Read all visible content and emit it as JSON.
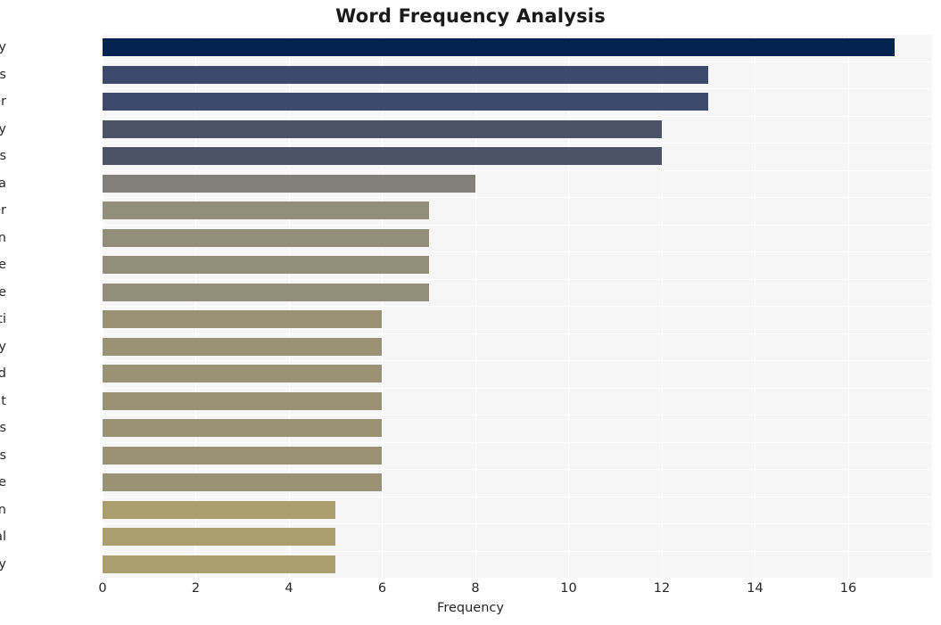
{
  "chart_data": {
    "type": "bar",
    "orientation": "horizontal",
    "title": "Word Frequency Analysis",
    "xlabel": "Frequency",
    "ylabel": "",
    "categories": [
      "security",
      "vulnerabilities",
      "cyber",
      "advisory",
      "organizations",
      "cisa",
      "partner",
      "exploitation",
      "infrastructure",
      "centre",
      "ivanti",
      "cybersecurity",
      "recommend",
      "threat",
      "actors",
      "malicious",
      "urge",
      "action",
      "national",
      "today"
    ],
    "values": [
      17,
      13,
      13,
      12,
      12,
      8,
      7,
      7,
      7,
      7,
      6,
      6,
      6,
      6,
      6,
      6,
      6,
      5,
      5,
      5
    ],
    "bar_colors": [
      "#04234f",
      "#3e4a6b",
      "#3e4a6b",
      "#4c5369",
      "#4c5369",
      "#82807b",
      "#938e7a",
      "#938e7a",
      "#938e7a",
      "#938e7a",
      "#9a9275",
      "#9a9275",
      "#9a9275",
      "#9a9275",
      "#9a9275",
      "#9a9275",
      "#9a9275",
      "#ab9e6e",
      "#ab9e6e",
      "#ab9e6e"
    ],
    "xlim": [
      0,
      17.8
    ],
    "xticks": [
      0,
      2,
      4,
      6,
      8,
      10,
      12,
      14,
      16
    ],
    "xtick_labels": [
      "0",
      "2",
      "4",
      "6",
      "8",
      "10",
      "12",
      "14",
      "16"
    ],
    "grid": true,
    "grid_color": "#ffffff",
    "plot_background": "#f6f6f7",
    "figure_background": "#ffffff",
    "legend": null,
    "title_color": "#1a1a1a",
    "tick_color": "#262626"
  }
}
